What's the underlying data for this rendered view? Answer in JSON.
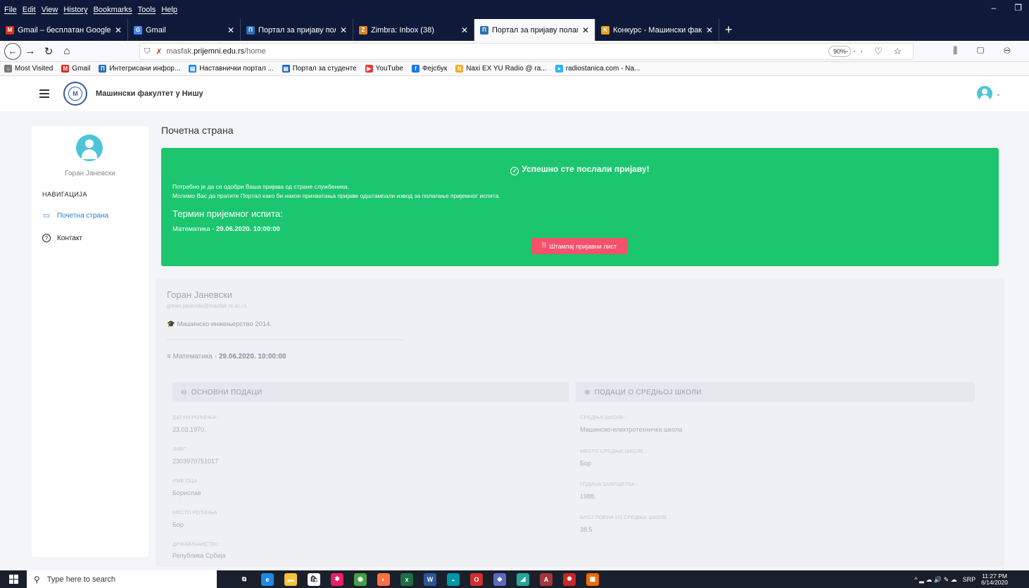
{
  "browser": {
    "menu": [
      "File",
      "Edit",
      "View",
      "History",
      "Bookmarks",
      "Tools",
      "Help"
    ],
    "window_controls": [
      "–",
      "❐"
    ],
    "tabs": [
      {
        "title": "Gmail – бесплатан Google ме",
        "favicon_color": "#d93025",
        "favicon": "M",
        "active": false
      },
      {
        "title": "Gmail",
        "favicon_color": "#4285f4",
        "favicon": "G",
        "active": false
      },
      {
        "title": "Портал за пријаву полагања",
        "favicon_color": "#2c6fb7",
        "favicon": "П",
        "active": false
      },
      {
        "title": "Zimbra: Inbox (38)",
        "favicon_color": "#d9822b",
        "favicon": "Z",
        "active": false
      },
      {
        "title": "Портал за пријаву полагања",
        "favicon_color": "#2c6fb7",
        "favicon": "П",
        "active": true
      },
      {
        "title": "Конкурс - Машински факулт",
        "favicon_color": "#e5a21d",
        "favicon": "K",
        "active": false
      }
    ],
    "new_tab": "+",
    "url_prefix": "masfak.",
    "url_host": "prijemni.edu.rs",
    "url_path": "/home",
    "zoom": "90%",
    "url_actions": "··· ♡ ☆",
    "nav_right": "⫼ ▢ ⊖",
    "bookmarks": [
      {
        "label": "Most Visited",
        "color": "#777",
        "glyph": "☼"
      },
      {
        "label": "Gmail",
        "color": "#d93025",
        "glyph": "M"
      },
      {
        "label": "Интегрисани инфор...",
        "color": "#2c6fb7",
        "glyph": "П"
      },
      {
        "label": "Наставнички портал ...",
        "color": "#1e88e5",
        "glyph": "▤"
      },
      {
        "label": "Портал за студенте",
        "color": "#1565c0",
        "glyph": "▤"
      },
      {
        "label": "YouTube",
        "color": "#e53935",
        "glyph": "▶"
      },
      {
        "label": "Фејсбук",
        "color": "#1877f2",
        "glyph": "f"
      },
      {
        "label": "Naxi EX YU Radio @ ra...",
        "color": "#f9a825",
        "glyph": "N"
      },
      {
        "label": "radiostanica.com - Na...",
        "color": "#29b6f6",
        "glyph": "●"
      }
    ]
  },
  "app": {
    "faculty_name": "Машински факултет у Нишу",
    "logo_text": "М",
    "user_caret": "⌄"
  },
  "sidebar": {
    "user_name": "Горан Јаневски",
    "nav_heading": "НАВИГАЦИЈА",
    "items": [
      {
        "label": "Почетна страна",
        "icon": "monitor-icon",
        "glyph": "▭",
        "active": true
      },
      {
        "label": "Контакт",
        "icon": "question-icon",
        "glyph": "?",
        "active": false
      }
    ]
  },
  "main": {
    "page_title": "Почетна страна",
    "alert": {
      "heading": "Успешно сте послали пријаву!",
      "check_glyph": "✓",
      "line1": "Потребно је да се одобри Ваша пријава од стране службеника.",
      "line2": "Молимо Вас да пратите Портал како би након прихватања пријаве одштампали извод за полагање пријемног испита.",
      "exam_heading": "Термин пријемног испита:",
      "exam_subject": "Математика - ",
      "exam_datetime": "29.06.2020. 10:00:00",
      "print_button": "Штампај пријавни лист",
      "print_icon": "🗎",
      "color": "#1bc66e",
      "button_color": "#f4516c"
    },
    "profile": {
      "name": "Горан Јаневски",
      "email": "goran.janevski@masfak.ni.ac.rs",
      "program_icon": "🎓",
      "program": "Машинско инжењерство 2014.",
      "exam_icon": "≡",
      "exam_subject": "Математика - ",
      "exam_datetime": "29.06.2020. 10:00:00",
      "basic_heading": "ОСНОВНИ ПОДАЦИ",
      "basic_icon": "⊖",
      "school_heading": "ПОДАЦИ О СРЕДЊОЈ ШКОЛИ",
      "school_icon": "⊕",
      "basic_fields": [
        {
          "label": "ДАТУМ РОЂЕЊА :",
          "value": "23.03.1970."
        },
        {
          "label": "ЈМБГ :",
          "value": "2303970751017"
        },
        {
          "label": "ИМЕ ОЦА :",
          "value": "Борислав"
        },
        {
          "label": "МЕСТО РОЂЕЊА :",
          "value": "Бор"
        },
        {
          "label": "ДРЖАВЉАНСТВО :",
          "value": "Република Србија"
        }
      ],
      "school_fields": [
        {
          "label": "СРЕДЊА ШКОЛА :",
          "value": "Машинско-електротехничка школа"
        },
        {
          "label": "МЕСТО СРЕДЊЕ ШКОЛЕ :",
          "value": "Бор"
        },
        {
          "label": "ГОДИНА ЗАВРШЕТКА :",
          "value": "1988."
        },
        {
          "label": "БРОЈ ПОЕНА ИЗ СРЕДЊЕ ШКОЛЕ :",
          "value": "38.5"
        }
      ]
    }
  },
  "taskbar": {
    "search_placeholder": "Type here to search",
    "search_icon": "⚲",
    "apps": [
      {
        "name": "task-view",
        "color": "#1a1f2c",
        "glyph": "⧉"
      },
      {
        "name": "edge",
        "color": "#1e88e5",
        "glyph": "e"
      },
      {
        "name": "file-explorer",
        "color": "#f9c23c",
        "glyph": "▬"
      },
      {
        "name": "store",
        "color": "#ffffff",
        "glyph": "🛍"
      },
      {
        "name": "app-1",
        "color": "#e91e63",
        "glyph": "✱"
      },
      {
        "name": "chrome",
        "color": "#43a047",
        "glyph": "◉"
      },
      {
        "name": "firefox",
        "color": "#ff7043",
        "glyph": "◐"
      },
      {
        "name": "excel",
        "color": "#1d6f42",
        "glyph": "x"
      },
      {
        "name": "word",
        "color": "#2b579a",
        "glyph": "W"
      },
      {
        "name": "app-2",
        "color": "#0097a7",
        "glyph": "◒"
      },
      {
        "name": "opera",
        "color": "#d32f2f",
        "glyph": "O"
      },
      {
        "name": "app-3",
        "color": "#5c6bc0",
        "glyph": "◆"
      },
      {
        "name": "app-4",
        "color": "#26a69a",
        "glyph": "◢"
      },
      {
        "name": "access",
        "color": "#a4373a",
        "glyph": "A"
      },
      {
        "name": "app-5",
        "color": "#c62828",
        "glyph": "✹"
      },
      {
        "name": "app-6",
        "color": "#ef6c00",
        "glyph": "▦"
      }
    ],
    "tray_icons": "^ ▂ ☁ 🔊 ✎ ☁",
    "language": "SRP",
    "time": "11:27 PM",
    "date": "6/14/2020"
  }
}
